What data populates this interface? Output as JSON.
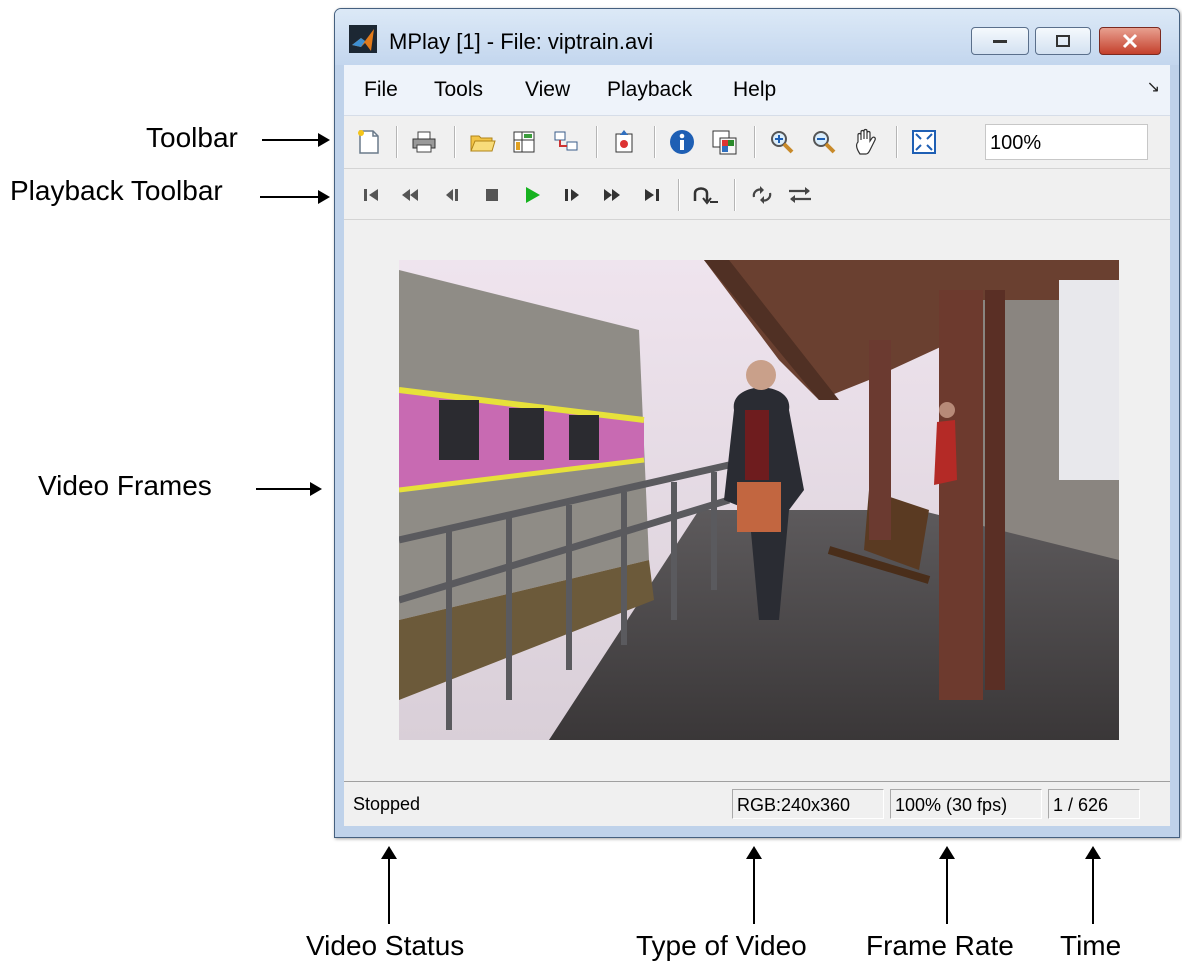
{
  "window": {
    "title": "MPlay [1] - File: viptrain.avi",
    "minimize_label": "Minimize",
    "maximize_label": "Maximize",
    "close_label": "Close"
  },
  "menu": {
    "items": [
      "File",
      "Tools",
      "View",
      "Playback",
      "Help"
    ],
    "corner_glyph": "↘"
  },
  "toolbar": {
    "icons": [
      "new-figure-icon",
      "print-icon",
      "open-folder-icon",
      "import-icon",
      "connect-icon",
      "export-icon",
      "info-icon",
      "colormap-icon",
      "zoom-in-icon",
      "zoom-out-icon",
      "pan-icon",
      "fit-to-view-icon"
    ],
    "zoom_value": "100%"
  },
  "playback_toolbar": {
    "icons": [
      "go-to-first-icon",
      "rewind-icon",
      "step-back-icon",
      "stop-icon",
      "play-icon",
      "step-forward-icon",
      "fast-forward-icon",
      "go-to-last-icon",
      "jump-to-icon",
      "loop-icon",
      "autoreverse-icon"
    ]
  },
  "status": {
    "state": "Stopped",
    "video_type": "RGB:240x360",
    "frame_rate": "100% (30 fps)",
    "frame_position": "1 / 626"
  },
  "annotations": {
    "toolbar": "Toolbar",
    "playback_toolbar": "Playback Toolbar",
    "video_frames": "Video Frames",
    "video_status": "Video Status",
    "type_of_video": "Type of Video",
    "frame_rate": "Frame Rate",
    "time": "Time"
  },
  "colors": {
    "play_green": "#16b21f",
    "icon_gray": "#555555",
    "close_red": "#c4402c",
    "title_gradient_top": "#dce9f7"
  }
}
